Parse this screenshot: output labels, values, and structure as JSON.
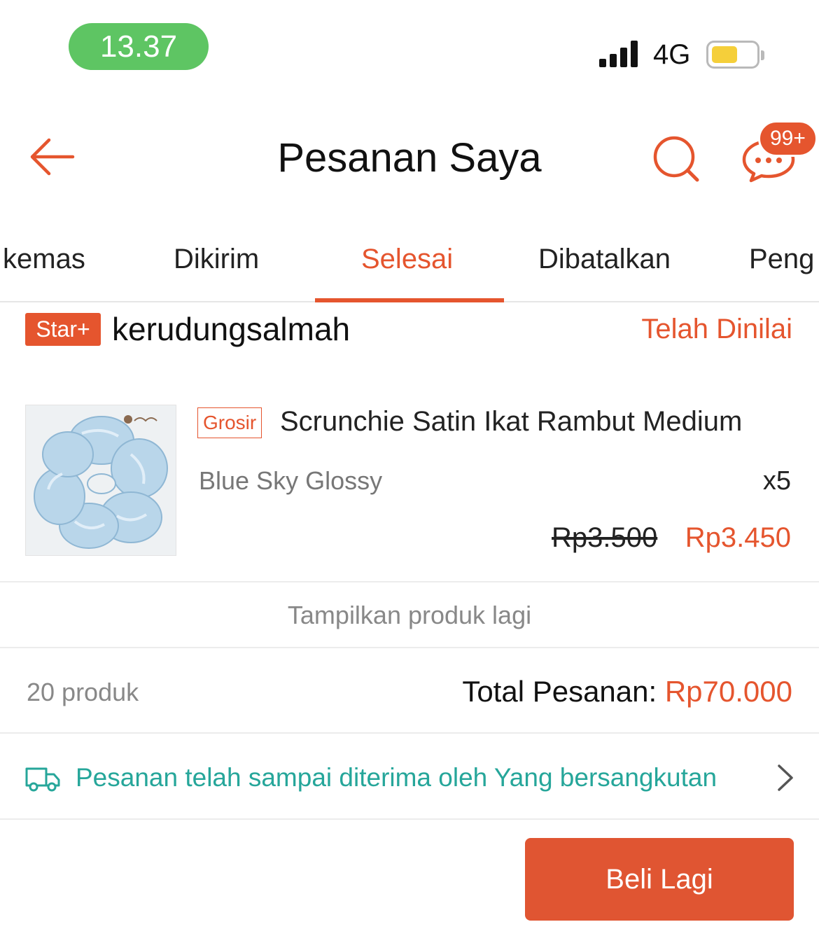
{
  "status_bar": {
    "time": "13.37",
    "network": "4G",
    "battery_color": "#f5cf3a"
  },
  "header": {
    "title": "Pesanan Saya",
    "back_icon": "arrow-left-icon",
    "search_icon": "search-icon",
    "chat_icon": "chat-icon",
    "chat_badge": "99+"
  },
  "tabs": [
    {
      "label": "kemas"
    },
    {
      "label": "Dikirim"
    },
    {
      "label": "Selesai",
      "active": true
    },
    {
      "label": "Dibatalkan"
    },
    {
      "label": "Peng"
    }
  ],
  "order": {
    "shop_badge": "Star+",
    "shop_name": "kerudungsalmah",
    "review_status": "Telah Dinilai",
    "product": {
      "tag": "Grosir",
      "name": "Scrunchie Satin Ikat Rambut Medium",
      "variant": "Blue Sky Glossy",
      "quantity": "x5",
      "original_price": "Rp3.500",
      "price": "Rp3.450"
    },
    "show_more": "Tampilkan produk lagi",
    "item_count": "20 produk",
    "total_label": "Total Pesanan: ",
    "total_amount": "Rp70.000",
    "shipping_status": "Pesanan telah sampai diterima oleh Yang bersangkutan",
    "buy_again": "Beli Lagi"
  },
  "colors": {
    "accent": "#e5552e",
    "shipping": "#26a69a",
    "time_pill": "#5ec563"
  }
}
